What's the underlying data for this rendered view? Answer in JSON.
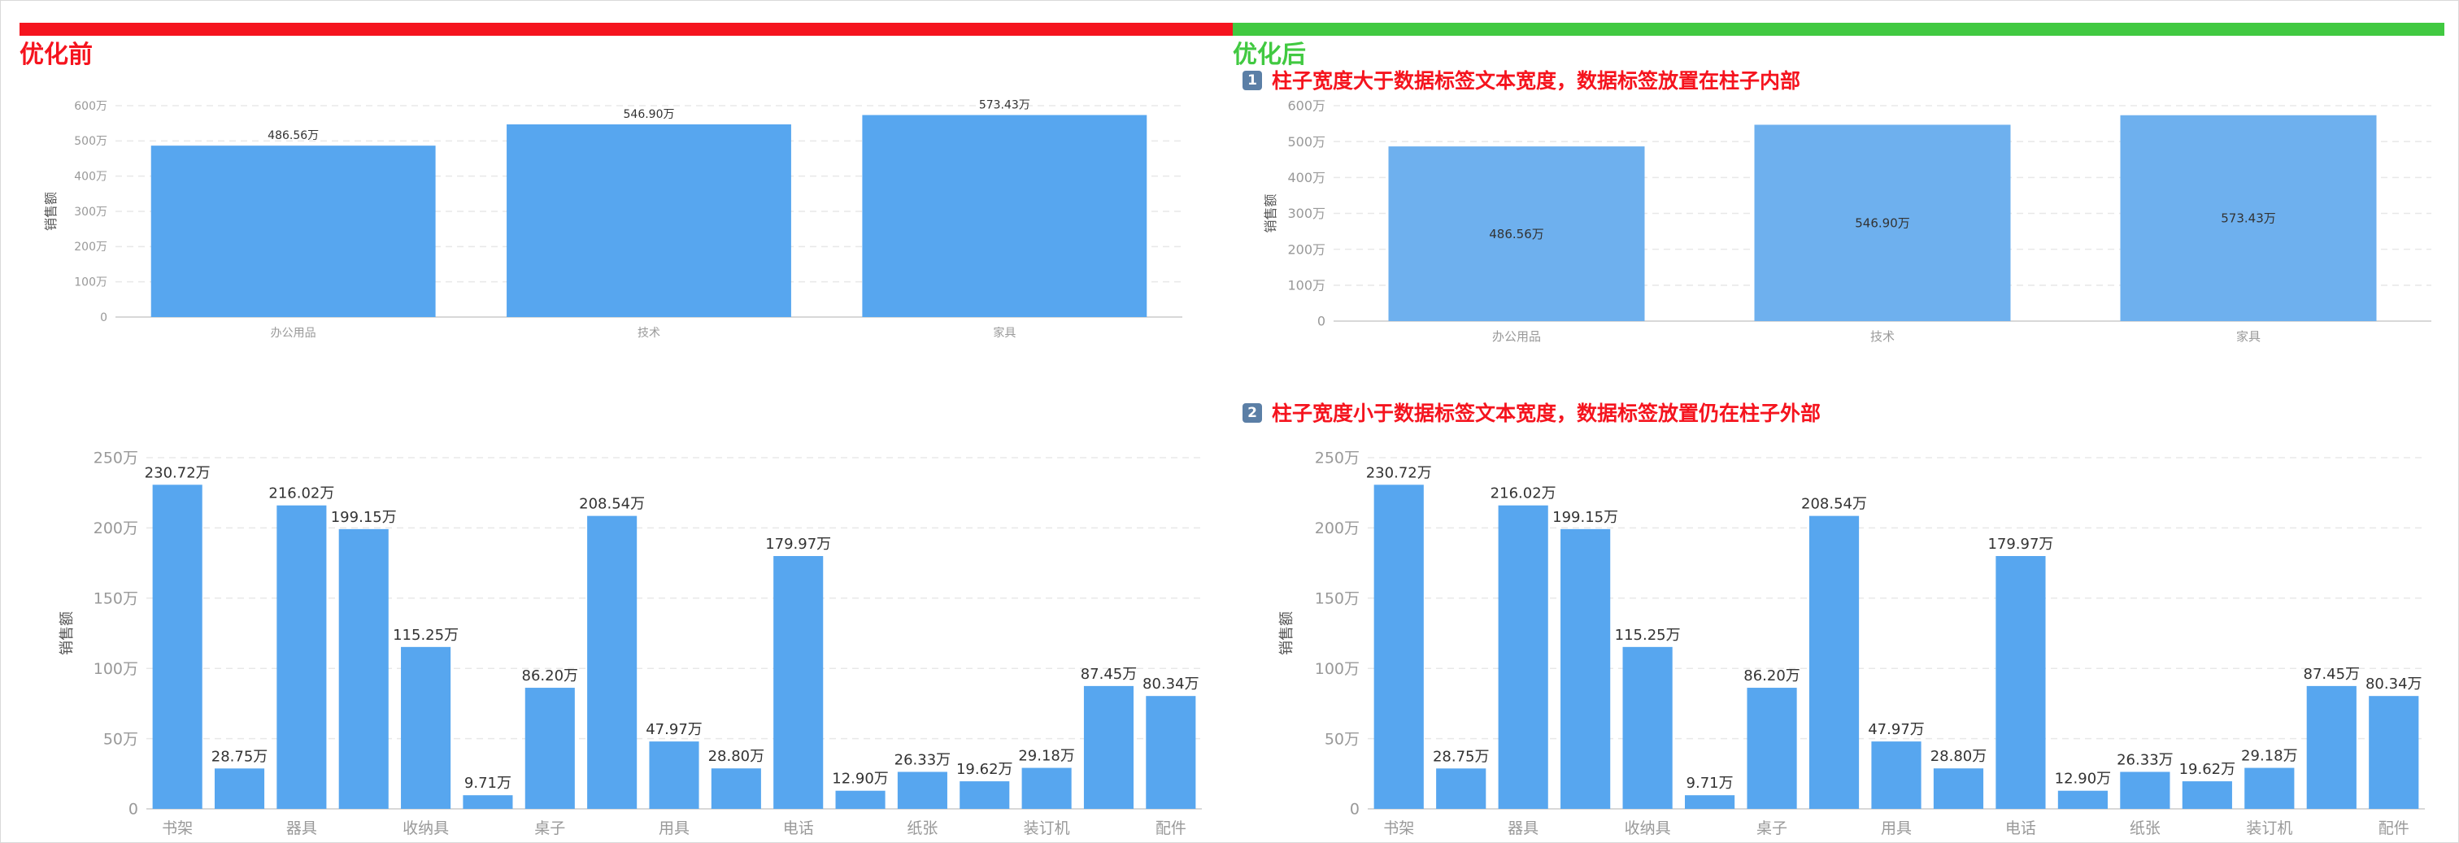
{
  "header": {
    "before_title": "优化前",
    "after_title": "优化后",
    "before_color": "#f5141e",
    "after_color": "#41c941"
  },
  "notes": [
    {
      "number": "1",
      "text": "柱子宽度大于数据标签文本宽度，数据标签放置在柱子内部",
      "color": "#f5141e"
    },
    {
      "number": "2",
      "text": "柱子宽度小于数据标签文本宽度，数据标签放置仍在柱子外部",
      "color": "#f5141e"
    }
  ],
  "colors": {
    "bar": "#57a6ef",
    "bar_light": "#6eb0ee",
    "grid": "#e8e8e8",
    "axis": "#cccccc"
  },
  "chart_data": [
    {
      "id": "chart-tl",
      "panel": "before",
      "type": "bar",
      "categories": [
        "办公用品",
        "技术",
        "家具"
      ],
      "values": [
        486.56,
        546.9,
        573.43
      ],
      "value_labels": [
        "486.56万",
        "546.90万",
        "573.43万"
      ],
      "label_position": "outside",
      "ylabel": "销售额",
      "ylim": [
        0,
        600
      ],
      "yticks": [
        0,
        100,
        200,
        300,
        400,
        500,
        600
      ],
      "ytick_labels": [
        "0",
        "100万",
        "200万",
        "300万",
        "400万",
        "500万",
        "600万"
      ],
      "grid": true
    },
    {
      "id": "chart-tr",
      "panel": "after",
      "type": "bar",
      "categories": [
        "办公用品",
        "技术",
        "家具"
      ],
      "values": [
        486.56,
        546.9,
        573.43
      ],
      "value_labels": [
        "486.56万",
        "546.90万",
        "573.43万"
      ],
      "label_position": "inside",
      "ylabel": "销售额",
      "ylim": [
        0,
        600
      ],
      "yticks": [
        0,
        100,
        200,
        300,
        400,
        500,
        600
      ],
      "ytick_labels": [
        "0",
        "100万",
        "200万",
        "300万",
        "400万",
        "500万",
        "600万"
      ],
      "grid": true
    },
    {
      "id": "chart-bl",
      "panel": "before",
      "type": "bar",
      "categories": [
        "书架",
        "",
        "器具",
        "",
        "收纳具",
        "",
        "桌子",
        "",
        "用具",
        "",
        "电话",
        "",
        "纸张",
        "",
        "装订机",
        "",
        "配件"
      ],
      "values": [
        230.72,
        28.75,
        216.02,
        199.15,
        115.25,
        9.71,
        86.2,
        208.54,
        47.97,
        28.8,
        179.97,
        12.9,
        26.33,
        19.62,
        29.18,
        87.45,
        80.34
      ],
      "value_labels": [
        "230.72万",
        "28.75万",
        "216.02万",
        "199.15万",
        "115.25万",
        "9.71万",
        "86.20万",
        "208.54万",
        "47.97万",
        "28.80万",
        "179.97万",
        "12.90万",
        "26.33万",
        "19.62万",
        "29.18万",
        "87.45万",
        "80.34万"
      ],
      "label_position": "outside",
      "ylabel": "销售额",
      "ylim": [
        0,
        250
      ],
      "yticks": [
        0,
        50,
        100,
        150,
        200,
        250
      ],
      "ytick_labels": [
        "0",
        "50万",
        "100万",
        "150万",
        "200万",
        "250万"
      ],
      "grid": true
    },
    {
      "id": "chart-br",
      "panel": "after",
      "type": "bar",
      "categories": [
        "书架",
        "",
        "器具",
        "",
        "收纳具",
        "",
        "桌子",
        "",
        "用具",
        "",
        "电话",
        "",
        "纸张",
        "",
        "装订机",
        "",
        "配件"
      ],
      "values": [
        230.72,
        28.75,
        216.02,
        199.15,
        115.25,
        9.71,
        86.2,
        208.54,
        47.97,
        28.8,
        179.97,
        12.9,
        26.33,
        19.62,
        29.18,
        87.45,
        80.34
      ],
      "value_labels": [
        "230.72万",
        "28.75万",
        "216.02万",
        "199.15万",
        "115.25万",
        "9.71万",
        "86.20万",
        "208.54万",
        "47.97万",
        "28.80万",
        "179.97万",
        "12.90万",
        "26.33万",
        "19.62万",
        "29.18万",
        "87.45万",
        "80.34万"
      ],
      "label_position": "outside",
      "ylabel": "销售额",
      "ylim": [
        0,
        250
      ],
      "yticks": [
        0,
        50,
        100,
        150,
        200,
        250
      ],
      "ytick_labels": [
        "0",
        "50万",
        "100万",
        "150万",
        "200万",
        "250万"
      ],
      "grid": true
    }
  ]
}
